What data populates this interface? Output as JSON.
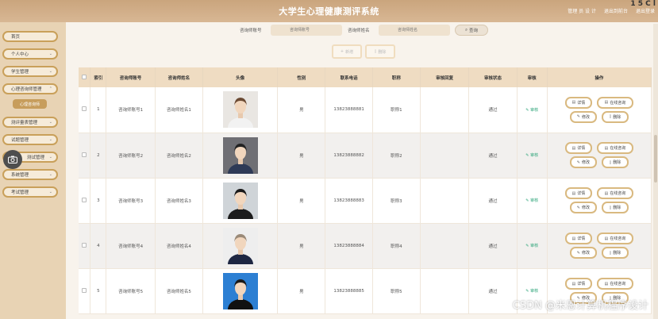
{
  "app": {
    "title": "大学生心理健康测评系统",
    "corner": "1 5 C l",
    "top_links": [
      "管理 员 设 计",
      "退出到前台",
      "退出登录"
    ]
  },
  "sidebar": {
    "items": [
      {
        "label": "首页",
        "has_arrow": false
      },
      {
        "label": "个人中心",
        "has_arrow": true
      },
      {
        "label": "学生管理",
        "has_arrow": true
      },
      {
        "label": "心理咨询师管理",
        "has_arrow": true
      },
      {
        "label": "测评量表管理",
        "has_arrow": true
      },
      {
        "label": "试题管理",
        "has_arrow": true
      },
      {
        "label": "测试管理",
        "has_arrow": true
      },
      {
        "label": "系统管理",
        "has_arrow": true
      },
      {
        "label": "考试管理",
        "has_arrow": true
      }
    ],
    "active_sub": "心理咨询师"
  },
  "search": {
    "field1_label": "咨询师账号",
    "field1_placeholder": "咨询师账号",
    "field2_label": "咨询师姓名",
    "field2_placeholder": "咨询师姓名",
    "button": "查询"
  },
  "actions": {
    "add": "新增",
    "delete": "删除"
  },
  "table": {
    "headers": [
      "索引",
      "咨询师账号",
      "咨询师姓名",
      "头像",
      "性别",
      "联系电话",
      "职称",
      "审核回复",
      "审核状态",
      "审核",
      "操作"
    ],
    "rows": [
      {
        "index": "1",
        "account": "咨询师账号1",
        "name": "咨询师姓名1",
        "gender": "男",
        "phone": "13823888881",
        "title": "职称1",
        "reply": "",
        "status": "通过",
        "audit": "审核"
      },
      {
        "index": "2",
        "account": "咨询师账号2",
        "name": "咨询师姓名2",
        "gender": "男",
        "phone": "13823888882",
        "title": "职称2",
        "reply": "",
        "status": "通过",
        "audit": "审核"
      },
      {
        "index": "3",
        "account": "咨询师账号3",
        "name": "咨询师姓名3",
        "gender": "男",
        "phone": "13823888883",
        "title": "职称3",
        "reply": "",
        "status": "通过",
        "audit": "审核"
      },
      {
        "index": "4",
        "account": "咨询师账号4",
        "name": "咨询师姓名4",
        "gender": "男",
        "phone": "13823888884",
        "title": "职称4",
        "reply": "",
        "status": "通过",
        "audit": "审核"
      },
      {
        "index": "5",
        "account": "咨询师账号5",
        "name": "咨询师姓名5",
        "gender": "男",
        "phone": "13823888885",
        "title": "职称5",
        "reply": "",
        "status": "通过",
        "audit": "审核"
      }
    ],
    "ops": {
      "detail": "详情",
      "chat": "在线咨询",
      "edit": "修改",
      "delete": "删除"
    }
  },
  "watermark": "CSDN @米恩计算机程序设计",
  "colors": {
    "accent": "#c9a05a",
    "topbar": "#caa57d",
    "header_row": "#efdcc2",
    "audit_green": "#2fa57a"
  }
}
